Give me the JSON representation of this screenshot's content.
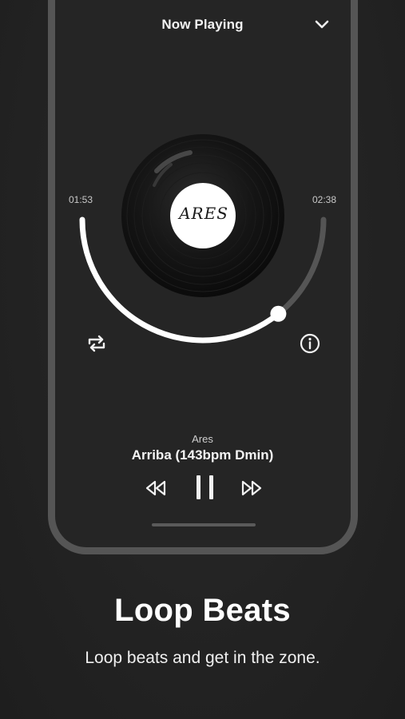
{
  "header": {
    "title": "Now Playing",
    "collapse_icon": "chevron-down-icon"
  },
  "player": {
    "elapsed": "01:53",
    "total": "02:38",
    "progress_fraction": 0.715,
    "record_label": "ARES",
    "repeat_icon": "repeat-icon",
    "info_icon": "info-icon",
    "artist": "Ares",
    "track": "Arriba (143bpm Dmin)",
    "controls": {
      "rewind_icon": "rewind-icon",
      "pause_icon": "pause-icon",
      "forward_icon": "fast-forward-icon"
    }
  },
  "promo": {
    "headline": "Loop Beats",
    "subtitle": "Loop beats and get in the zone."
  },
  "colors": {
    "background": "#232323",
    "phone_frame": "#555555",
    "accent": "#ffffff",
    "track_inactive": "#555555"
  }
}
